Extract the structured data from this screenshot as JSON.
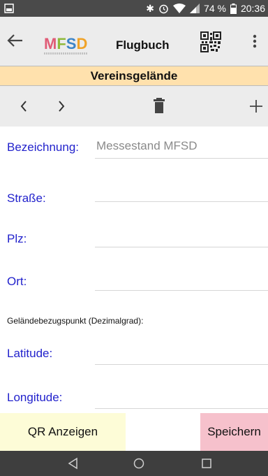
{
  "status_bar": {
    "battery_percent": "74 %",
    "time": "20:36",
    "icons": [
      "notification-icon",
      "bluetooth-icon",
      "alarm-icon",
      "wifi-icon",
      "signal-icon",
      "battery-icon"
    ]
  },
  "app_bar": {
    "back_icon": "back-arrow-icon",
    "logo_text": {
      "m": "M",
      "f": "F",
      "s": "S",
      "d": "D"
    },
    "title": "Flugbuch",
    "qr_icon": "qr-code-icon",
    "menu_icon": "overflow-menu-icon"
  },
  "section": {
    "title": "Vereinsgelände"
  },
  "toolbar": {
    "prev_icon": "chevron-left-icon",
    "next_icon": "chevron-right-icon",
    "delete_icon": "trash-icon",
    "add_icon": "plus-icon"
  },
  "form": {
    "bezeichnung": {
      "label": "Bezeichnung:",
      "value": "Messestand MFSD"
    },
    "strasse": {
      "label": "Straße:",
      "value": ""
    },
    "plz": {
      "label": "Plz:",
      "value": ""
    },
    "ort": {
      "label": "Ort:",
      "value": ""
    },
    "subheading": "Geländebezugspunkt (Dezimalgrad):",
    "latitude": {
      "label": "Latitude:",
      "value": ""
    },
    "longitude": {
      "label": "Longitude:",
      "value": ""
    }
  },
  "buttons": {
    "qr": "QR Anzeigen",
    "save": "Speichern"
  },
  "colors": {
    "label_blue": "#2222cc",
    "section_header_bg": "#ffe1ad",
    "qr_button_bg": "#fdfcd7",
    "save_button_bg": "#f6c1cc"
  },
  "system_nav": {
    "icons": [
      "nav-back-icon",
      "nav-home-icon",
      "nav-recents-icon"
    ]
  }
}
